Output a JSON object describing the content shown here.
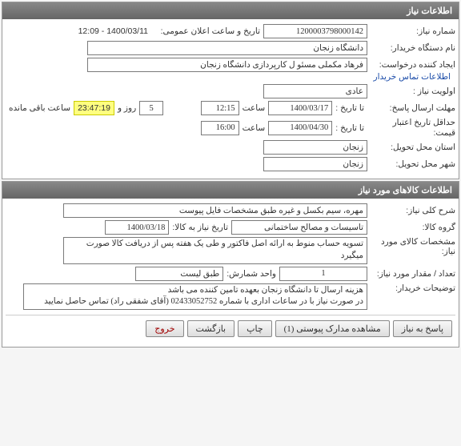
{
  "panel1": {
    "title": "اطلاعات نیاز",
    "need_no_label": "شماره نیاز:",
    "need_no": "1200003798000142",
    "announce_label": "تاریخ و ساعت اعلان عمومی:",
    "announce_val": "1400/03/11 - 12:09",
    "buyer_label": "نام دستگاه خریدار:",
    "buyer_val": "دانشگاه زنجان",
    "requester_label": "ایجاد کننده درخواست:",
    "requester_val": "فرهاد مکملی مسئو ل کارپردازی دانشگاه زنجان",
    "priority_label": "اولویت نیاز :",
    "priority_val": "عادی",
    "deadline_label": "مهلت ارسال پاسخ:",
    "until_label": "تا تاریخ :",
    "deadline_date": "1400/03/17",
    "time_label": "ساعت",
    "deadline_time": "12:15",
    "days_val": "5",
    "days_label": "روز و",
    "countdown": "23:47:19",
    "remaining_label": "ساعت باقی مانده",
    "min_valid_label": "حداقل تاریخ اعتبار قیمت:",
    "valid_until_label": "تا تاریخ :",
    "valid_date": "1400/04/30",
    "valid_time": "16:00",
    "deliver_state_label": "استان محل تحویل:",
    "deliver_state": "زنجان",
    "deliver_city_label": "شهر محل تحویل:",
    "deliver_city": "زنجان",
    "contact_link": "اطلاعات تماس خریدار"
  },
  "panel2": {
    "title": "اطلاعات کالاهای مورد نیاز",
    "desc_label": "شرح کلی نیاز:",
    "desc_val": "مهره، سیم بکسل و غیره طبق مشخصات فایل پیوست",
    "group_label": "گروه کالا:",
    "group_val": "تاسیسات و مصالح ساختمانی",
    "need_until_label": "تاریخ نیاز به کالا:",
    "need_until": "1400/03/18",
    "spec_label": "مشخصات کالای مورد نیاز:",
    "spec_val": "تسویه حساب منوط به ارائه اصل فاکتور و طی یک هفته پس از دریافت کالا صورت میگیرد",
    "qty_label": "تعداد / مقدار مورد نیاز:",
    "qty_val": "1",
    "unit_label": "واحد شمارش:",
    "unit_val": "طبق لیست",
    "notes_label": "توضیحات خریدار:",
    "notes_val": "هزینه ارسال تا دانشگاه زنجان بعهده تامین کننده می باشد\nدر صورت نیاز با در ساعات اداری با شماره 02433052752 (آقای شفقی راد) تماس حاصل نمایید"
  },
  "buttons": {
    "reply": "پاسخ به نیاز",
    "attachments": "مشاهده مدارک پیوستی  (1)",
    "print": "چاپ",
    "back": "بازگشت",
    "exit": "خروج"
  }
}
